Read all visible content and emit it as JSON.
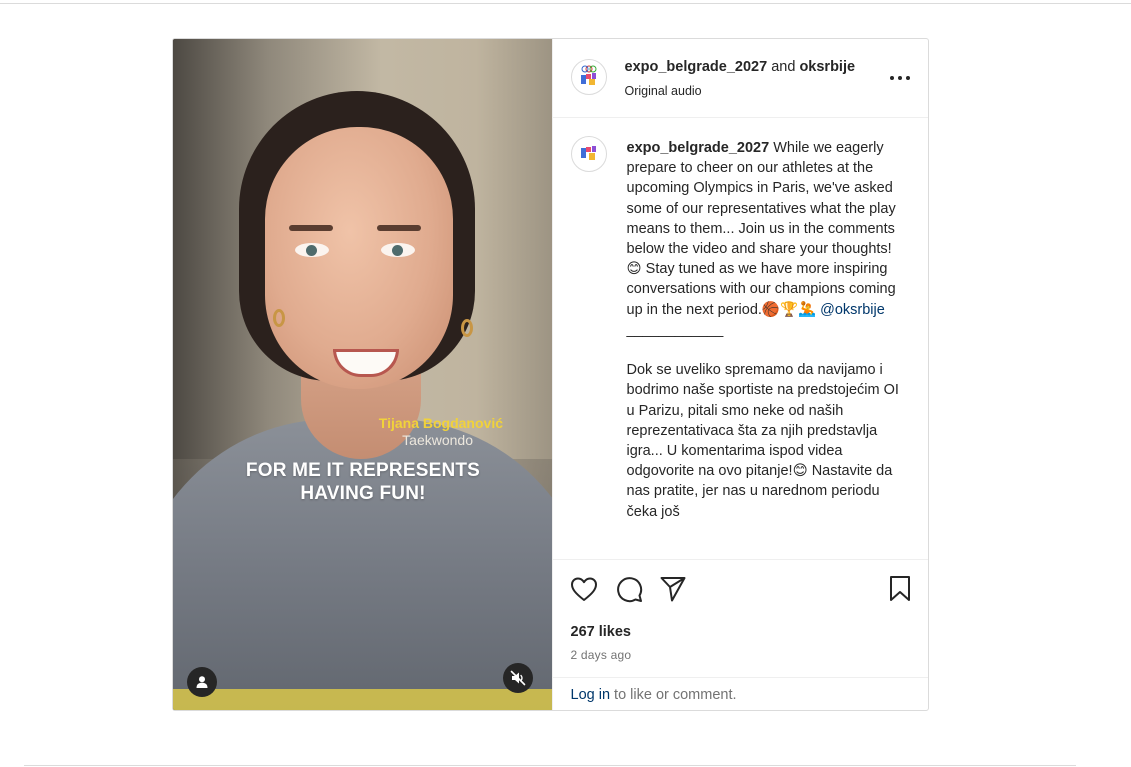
{
  "video": {
    "athlete_name": "Tijana Bogdanović",
    "athlete_sport": "Taekwondo",
    "quote_line1": "FOR ME IT REPRESENTS",
    "quote_line2": "HAVING FUN!",
    "user_icon": "person-icon",
    "mute_icon": "muted-speaker-icon"
  },
  "header": {
    "username1": "expo_belgrade_2027",
    "joiner": "and",
    "username2": "oksrbije",
    "subtitle": "Original audio",
    "more_icon": "more-horizontal-icon",
    "more_label": "•••"
  },
  "caption": {
    "username": "expo_belgrade_2027",
    "text_en": " While we eagerly prepare to cheer on our athletes at the upcoming Olympics in Paris, we've asked some of our representatives what the play means to them... Join us in the comments below the video and share your thoughts!😊 Stay tuned as we have more inspiring conversations with our champions coming up in the next period.🏀🏆🤽 ",
    "mention": "@oksrbije",
    "divider": "\n____________\n\n",
    "text_sr": "Dok se uveliko spremamo da navijamo i bodrimo naše sportiste na predstojećim OI u Parizu, pitali smo neke od naših reprezentativaca šta za njih predstavlja igra... U komentarima ispod videa odgovorite na ovo pitanje!😊 Nastavite da nas pratite, jer nas u narednom periodu čeka još"
  },
  "actions": {
    "like_icon": "heart-icon",
    "comment_icon": "comment-icon",
    "share_icon": "send-icon",
    "save_icon": "bookmark-icon"
  },
  "stats": {
    "likes": "267 likes",
    "date": "2 days ago"
  },
  "footer": {
    "login_link": "Log in",
    "login_rest": " to like or comment."
  }
}
